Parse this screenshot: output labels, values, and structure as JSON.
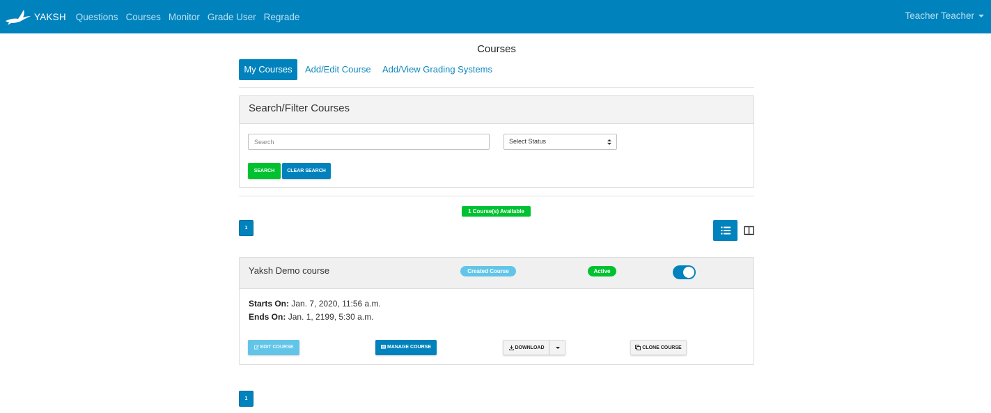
{
  "navbar": {
    "brand": "YAKSH",
    "links": [
      "Questions",
      "Courses",
      "Monitor",
      "Grade User",
      "Regrade"
    ],
    "user": "Teacher Teacher"
  },
  "page": {
    "title": "Courses",
    "tabs": [
      "My Courses",
      "Add/Edit Course",
      "Add/View Grading Systems"
    ]
  },
  "filter": {
    "heading": "Search/Filter Courses",
    "search_placeholder": "Search",
    "status_select": "Select Status",
    "search_button": "SEARCH",
    "clear_button": "CLEAR SEARCH"
  },
  "results": {
    "count_badge": "1 Course(s) Available",
    "page_number": "1"
  },
  "course": {
    "name": "Yaksh Demo course",
    "created_badge": "Created Course",
    "status_badge": "Active",
    "toggle_on": true,
    "starts_label": "Starts On:",
    "starts_value": "Jan. 7, 2020, 11:56 a.m.",
    "ends_label": "Ends On:",
    "ends_value": "Jan. 1, 2199, 5:30 a.m.",
    "edit_button": "EDIT COURSE",
    "manage_button": "MANAGE COURSE",
    "download_button": "DOWNLOAD",
    "clone_button": "CLONE COURSE"
  },
  "colors": {
    "primary": "#0082bd",
    "success": "#00c230",
    "info": "#62c5e8"
  }
}
